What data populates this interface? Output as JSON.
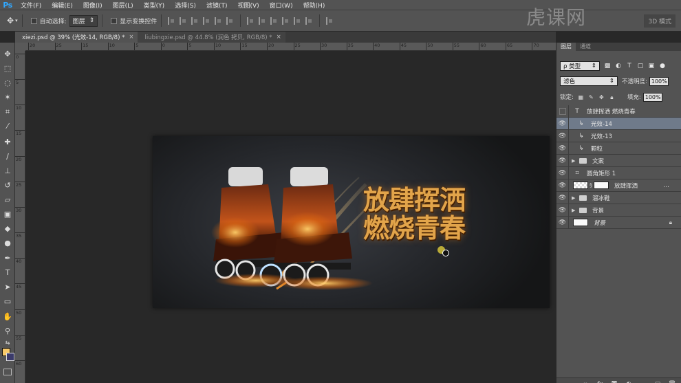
{
  "app": {
    "logo": "Ps"
  },
  "menu": [
    "文件(F)",
    "编辑(E)",
    "图像(I)",
    "图层(L)",
    "类型(Y)",
    "选择(S)",
    "滤镜(T)",
    "视图(V)",
    "窗口(W)",
    "帮助(H)"
  ],
  "options": {
    "auto_select_label": "自动选择:",
    "auto_select_value": "图层",
    "show_transform_label": "显示变换控件",
    "mode_3d": "3D 模式"
  },
  "tabs": [
    {
      "label": "xiezi.psd @ 39% (光效-14, RGB/8) *",
      "close": "×"
    },
    {
      "label": "liubingxie.psd @ 44.8% (润色 拷贝, RGB/8) *",
      "close": "×"
    }
  ],
  "ruler_h": [
    "20",
    "25",
    "15",
    "10",
    "5",
    "0",
    "5",
    "10",
    "15",
    "20",
    "25",
    "30",
    "35",
    "40",
    "45",
    "50",
    "55",
    "60",
    "65",
    "70"
  ],
  "ruler_v": [
    "0",
    "5",
    "10",
    "15",
    "20",
    "25",
    "30",
    "35",
    "40",
    "45",
    "50",
    "55",
    "60"
  ],
  "canvas": {
    "headline_line1": "放肆挥洒",
    "headline_line2": "燃烧青春"
  },
  "panel": {
    "tab_layers": "图层",
    "tab_channels": "通道",
    "filter_kind": "ρ 类型",
    "blend_mode": "滤色",
    "opacity_label": "不透明度:",
    "opacity_value": "100%",
    "lock_label": "锁定:",
    "fill_label": "填充:",
    "fill_value": "100%",
    "layers": [
      {
        "name": "放肆挥洒    燃烧青春",
        "kind": "text",
        "visible": false
      },
      {
        "name": "光效-14",
        "kind": "clip",
        "visible": true,
        "selected": true
      },
      {
        "name": "光效-13",
        "kind": "clip",
        "visible": true
      },
      {
        "name": "颗粒",
        "kind": "clip",
        "visible": true
      },
      {
        "name": "文案",
        "kind": "group",
        "visible": true
      },
      {
        "name": "圆角矩形 1",
        "kind": "shape",
        "visible": true
      },
      {
        "name": "放肆挥洒",
        "kind": "masked",
        "visible": true
      },
      {
        "name": "溜冰鞋",
        "kind": "group",
        "visible": true
      },
      {
        "name": "背景",
        "kind": "group",
        "visible": true
      },
      {
        "name": "背景",
        "kind": "background",
        "visible": true
      }
    ]
  },
  "watermark": "虎课网",
  "colors": {
    "foreground": "#f7c96a",
    "background": "#3b3b6b",
    "accent": "#31a8ff"
  }
}
